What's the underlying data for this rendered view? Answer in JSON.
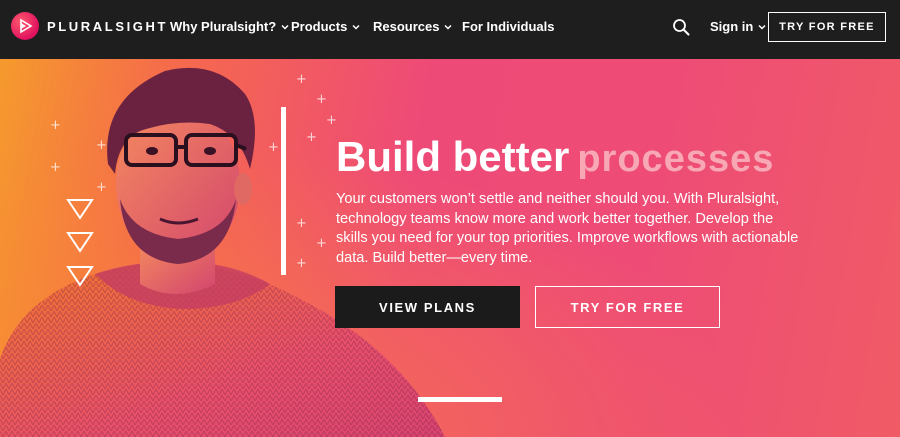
{
  "nav": {
    "brand": "PLURALSIGHT",
    "items": [
      {
        "label": "Why Pluralsight?",
        "has_dropdown": true
      },
      {
        "label": "Products",
        "has_dropdown": true
      },
      {
        "label": "Resources",
        "has_dropdown": true
      },
      {
        "label": "For Individuals",
        "has_dropdown": false
      }
    ],
    "sign_in": "Sign in",
    "try_free": "TRY FOR FREE"
  },
  "hero": {
    "headline_main": "Build better",
    "headline_accent": "processes",
    "description": "Your customers won’t settle and neither should you. With Pluralsight, technology teams know more and work better together. Develop the skills you need for your top priorities. Improve workflows with actionable data. Build better—every time.",
    "primary_cta": "VIEW PLANS",
    "secondary_cta": "TRY FOR FREE"
  },
  "icons": [
    "pluralsight-logo-icon",
    "chevron-down-icon",
    "search-icon",
    "triangle-outline-icon",
    "plus-icon"
  ],
  "colors": {
    "nav_bg": "#1e1e1e",
    "brand_pink": "#e0115f",
    "accent_text": "#f7a8b4",
    "dark_button": "#1b1b1b"
  }
}
